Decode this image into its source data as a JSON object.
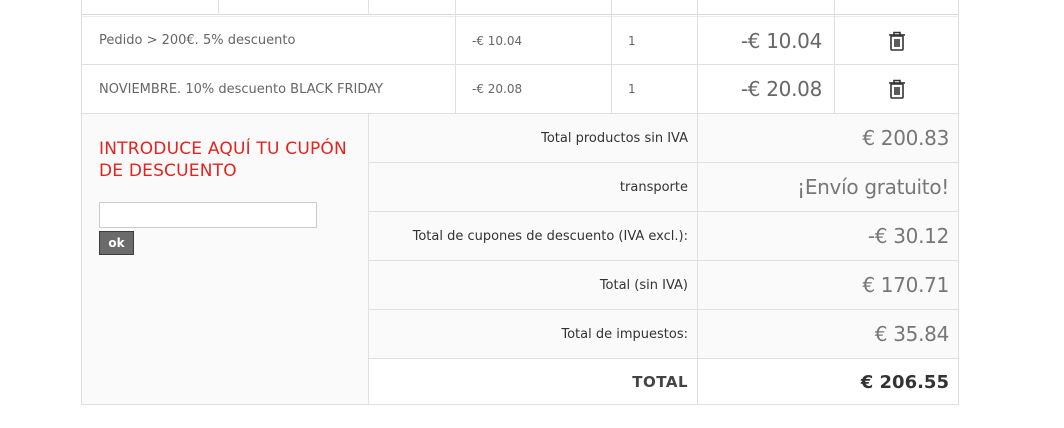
{
  "discounts": [
    {
      "name": "Pedido > 200€. 5% descuento",
      "unit": "-€ 10.04",
      "qty": "1",
      "total": "-€ 10.04",
      "action_icon": "trash-icon"
    },
    {
      "name": "NOVIEMBRE. 10% descuento BLACK FRIDAY",
      "unit": "-€ 20.08",
      "qty": "1",
      "total": "-€ 20.08",
      "action_icon": "trash-icon"
    }
  ],
  "coupon": {
    "title": "Introduce aquí tu cupón de descuento",
    "input_value": "",
    "button_label": "ok"
  },
  "summary": [
    {
      "label": "Total productos sin IVA",
      "value": "€ 200.83"
    },
    {
      "label": "transporte",
      "value": "¡Envío gratuito!"
    },
    {
      "label": "Total de cupones de descuento (IVA excl.):",
      "value": "-€ 30.12"
    },
    {
      "label": "Total (sin IVA)",
      "value": "€ 170.71"
    },
    {
      "label": "Total de impuestos:",
      "value": "€ 35.84"
    },
    {
      "label": "TOTAL",
      "value": "€ 206.55"
    }
  ],
  "colors": {
    "accent": "#e4231f",
    "border": "#e0e0e0",
    "button": "#6b6b6b"
  }
}
